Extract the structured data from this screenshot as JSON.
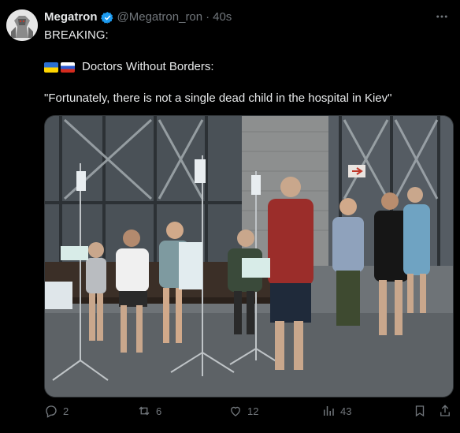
{
  "tweet": {
    "author_name": "Megatron",
    "author_handle": "@Megatron_ron",
    "separator": "·",
    "time": "40s",
    "more_icon": "ellipsis-icon",
    "line1": "BREAKING:",
    "line2": "Doctors Without Borders:",
    "line3": "\"Fortunately, there is not a single dead child in the hospital in Kiev\"",
    "flags": [
      "ukraine-flag-icon",
      "russia-flag-icon"
    ],
    "verified_color": "#1d9bf0"
  },
  "actions": {
    "replies": "2",
    "retweets": "6",
    "likes": "12",
    "views": "43"
  },
  "colors": {
    "background": "#000000",
    "text": "#e7e9ea",
    "muted": "#71767b"
  }
}
